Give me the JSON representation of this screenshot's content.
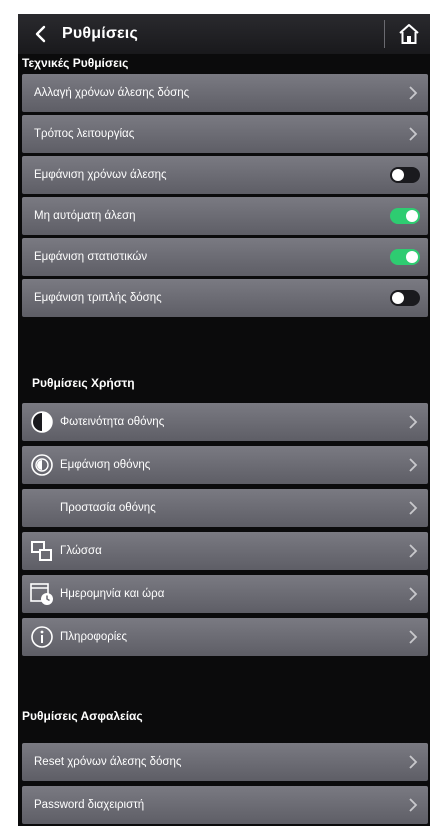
{
  "header": {
    "title": "Ρυθμίσεις"
  },
  "sections": {
    "technical": "Τεχνικές Ρυθμίσεις",
    "user": "Ρυθμίσεις Χρήστη",
    "security": "Ρυθμίσεις Ασφαλείας"
  },
  "technical_rows": [
    {
      "label": "Αλλαγή χρόνων άλεσης δόσης",
      "control": "chevron"
    },
    {
      "label": "Τρόπος λειτουργίας",
      "control": "chevron"
    },
    {
      "label": "Εμφάνιση χρόνων άλεσης",
      "control": "toggle",
      "state": "off"
    },
    {
      "label": "Μη αυτόματη άλεση",
      "control": "toggle",
      "state": "on"
    },
    {
      "label": "Εμφάνιση στατιστικών",
      "control": "toggle",
      "state": "on"
    },
    {
      "label": "Εμφάνιση τριπλής δόσης",
      "control": "toggle",
      "state": "off"
    }
  ],
  "user_rows": [
    {
      "label": "Φωτεινότητα οθόνης",
      "icon": "brightness-icon"
    },
    {
      "label": "Εμφάνιση οθόνης",
      "icon": "display-icon"
    },
    {
      "label": "Προστασία οθόνης",
      "icon": "screensaver-icon"
    },
    {
      "label": "Γλώσσα",
      "icon": "language-icon"
    },
    {
      "label": "Ημερομηνία και ώρα",
      "icon": "calendar-clock-icon"
    },
    {
      "label": "Πληροφορίες",
      "icon": "info-icon"
    }
  ],
  "security_rows": [
    {
      "label": "Reset χρόνων άλεσης δόσης"
    },
    {
      "label": "Password διαχειριστή"
    }
  ],
  "colors": {
    "toggle_on": "#2ecc71",
    "row_bg": "#6b6b73",
    "screen_bg": "#0b0b0c"
  }
}
